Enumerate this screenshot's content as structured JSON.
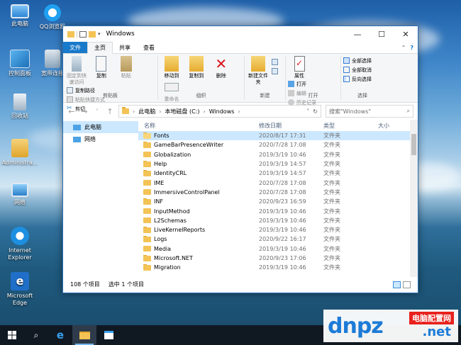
{
  "desktop": {
    "icons": [
      {
        "label": "此电脑",
        "icon": "computer-icon"
      },
      {
        "label": "QQ浏览器",
        "icon": "qq-browser-icon"
      },
      {
        "label": "控制面板",
        "icon": "control-panel-icon"
      },
      {
        "label": "宽带连接",
        "icon": "broadband-icon"
      },
      {
        "label": "回收站",
        "icon": "recycle-bin-icon"
      },
      {
        "label": "Administra...",
        "icon": "user-folder-icon"
      },
      {
        "label": "网络",
        "icon": "network-icon"
      },
      {
        "label": "Internet Explorer",
        "icon": "ie-icon"
      },
      {
        "label": "Microsoft Edge",
        "icon": "edge-icon"
      }
    ]
  },
  "window": {
    "title": "Windows",
    "controls": {
      "minimize": "—",
      "maximize": "☐",
      "close": "✕"
    }
  },
  "ribbon": {
    "tabs": [
      "文件",
      "主页",
      "共享",
      "查看"
    ],
    "groups": {
      "clipboard": {
        "label": "剪贴板",
        "pin": "固定到快速访问",
        "copy": "复制",
        "paste": "粘贴",
        "copy_path": "复制路径",
        "paste_shortcut": "粘贴快捷方式",
        "cut": "剪切"
      },
      "organize": {
        "label": "组织",
        "move_to": "移动到",
        "copy_to": "复制到",
        "delete": "删除",
        "rename": "重命名"
      },
      "new": {
        "label": "新建",
        "new_folder": "新建文件夹"
      },
      "open": {
        "label": "打开",
        "properties": "属性",
        "open": "打开",
        "edit": "编辑",
        "history": "历史记录"
      },
      "select": {
        "label": "选择",
        "select_all": "全部选择",
        "select_none": "全部取消",
        "invert": "反向选择"
      }
    }
  },
  "address": {
    "crumbs": [
      "此电脑",
      "本地磁盘 (C:)",
      "Windows"
    ],
    "search_placeholder": "搜索\"Windows\""
  },
  "nav_pane": {
    "items": [
      "此电脑",
      "网络"
    ]
  },
  "columns": {
    "name": "名称",
    "modified": "修改日期",
    "type": "类型",
    "size": "大小"
  },
  "files": [
    {
      "name": "Fonts",
      "modified": "2020/8/17 17:31",
      "type": "文件夹"
    },
    {
      "name": "GameBarPresenceWriter",
      "modified": "2020/7/28 17:08",
      "type": "文件夹"
    },
    {
      "name": "Globalization",
      "modified": "2019/3/19 10:46",
      "type": "文件夹"
    },
    {
      "name": "Help",
      "modified": "2019/3/19 14:57",
      "type": "文件夹"
    },
    {
      "name": "IdentityCRL",
      "modified": "2019/3/19 14:57",
      "type": "文件夹"
    },
    {
      "name": "IME",
      "modified": "2020/7/28 17:08",
      "type": "文件夹"
    },
    {
      "name": "ImmersiveControlPanel",
      "modified": "2020/7/28 17:08",
      "type": "文件夹"
    },
    {
      "name": "INF",
      "modified": "2020/9/23 16:59",
      "type": "文件夹"
    },
    {
      "name": "InputMethod",
      "modified": "2019/3/19 10:46",
      "type": "文件夹"
    },
    {
      "name": "L2Schemas",
      "modified": "2019/3/19 10:46",
      "type": "文件夹"
    },
    {
      "name": "LiveKernelReports",
      "modified": "2019/3/19 10:46",
      "type": "文件夹"
    },
    {
      "name": "Logs",
      "modified": "2020/9/22 16:17",
      "type": "文件夹"
    },
    {
      "name": "Media",
      "modified": "2019/3/19 10:46",
      "type": "文件夹"
    },
    {
      "name": "Microsoft.NET",
      "modified": "2020/9/23 17:06",
      "type": "文件夹"
    },
    {
      "name": "Migration",
      "modified": "2019/3/19 10:46",
      "type": "文件夹"
    }
  ],
  "status": {
    "count": "108 个项目",
    "selected": "选中 1 个项目"
  },
  "taskbar": {
    "items": [
      "windows-start-icon",
      "search-icon",
      "edge-icon",
      "file-explorer-icon",
      "store-icon"
    ]
  },
  "watermark": {
    "brand": "dnpz",
    "tagline": "电脑配置网",
    "domain": ".net"
  },
  "colors": {
    "accent": "#1979ca",
    "selection": "#cce8ff",
    "folder": "#f3c356"
  }
}
